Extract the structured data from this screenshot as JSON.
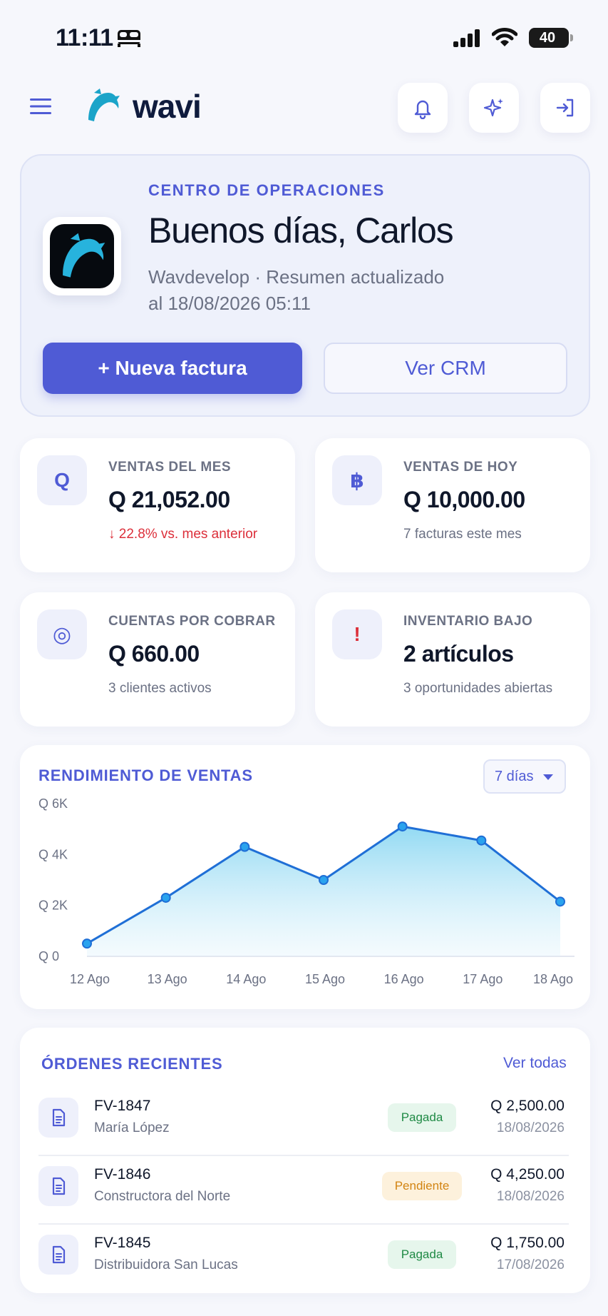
{
  "status_bar": {
    "time": "11:11",
    "battery": "40"
  },
  "header": {
    "brand": "wavi"
  },
  "hero": {
    "eyebrow": "CENTRO DE OPERACIONES",
    "title": "Buenos días, Carlos",
    "subtitle": "Wavdevelop · Resumen actualizado al 18/08/2026 05:11",
    "primary_action": "+ Nueva factura",
    "secondary_action": "Ver CRM"
  },
  "stats": [
    {
      "icon": "Q",
      "label": "VENTAS DEL MES",
      "value": "Q 21,052.00",
      "note": "↓ 22.8% vs. mes anterior"
    },
    {
      "icon": "฿",
      "label": "VENTAS DE HOY",
      "value": "Q 10,000.00",
      "note": "7 facturas este mes"
    },
    {
      "icon": "◎",
      "label": "CUENTAS POR COBRAR",
      "value": "Q 660.00",
      "note": "3 clientes activos"
    },
    {
      "icon": "!",
      "label": "INVENTARIO BAJO",
      "value": "2 artículos",
      "note": "3 oportunidades abiertas"
    }
  ],
  "colors": {
    "accent": "#4f5bd5",
    "negative": "#dc2f3a",
    "line": "#1f6fd6",
    "area": "#7fd3f1"
  },
  "chart_section": {
    "title": "RENDIMIENTO DE VENTAS",
    "range": "7 días"
  },
  "chart_data": {
    "type": "area",
    "categories": [
      "12 Ago",
      "13 Ago",
      "14 Ago",
      "15 Ago",
      "16 Ago",
      "17 Ago",
      "18 Ago"
    ],
    "series": [
      {
        "values": [
          500,
          2300,
          4300,
          3000,
          5100,
          4550,
          2150
        ]
      }
    ],
    "y_ticks": [
      "Q 0",
      "Q 2K",
      "Q 4K",
      "Q 6K"
    ],
    "ylim": [
      0,
      6000
    ],
    "grid": false
  },
  "orders": {
    "title": "ÓRDENES RECIENTES",
    "view_all": "Ver todas",
    "rows": [
      {
        "id": "FV-1847",
        "client": "María López",
        "status": "Pagada",
        "status_kind": "paid",
        "amount": "Q 2,500.00",
        "date": "18/08/2026"
      },
      {
        "id": "FV-1846",
        "client": "Constructora del Norte",
        "status": "Pendiente",
        "status_kind": "pending",
        "amount": "Q 4,250.00",
        "date": "18/08/2026"
      },
      {
        "id": "FV-1845",
        "client": "Distribuidora San Lucas",
        "status": "Pagada",
        "status_kind": "paid",
        "amount": "Q 1,750.00",
        "date": "17/08/2026"
      }
    ]
  }
}
